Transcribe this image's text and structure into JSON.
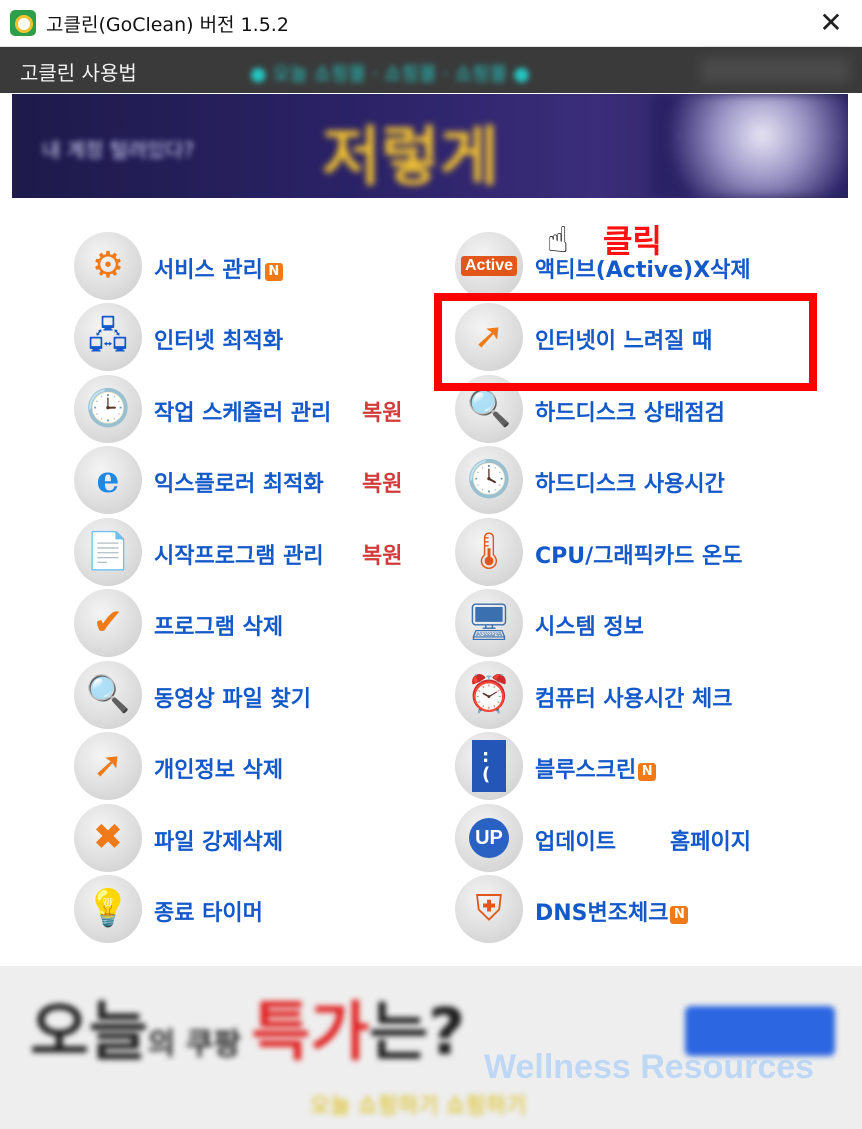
{
  "window": {
    "title": "고클린(GoClean) 버전 1.5.2",
    "close_glyph": "✕"
  },
  "menubar": {
    "usage": "고클린 사용법",
    "marquee": "● 오늘 쇼핑몰 · 쇼핑몰 · 쇼핑몰 ●"
  },
  "banner_top": {
    "small": "내 계정 털려있다?",
    "big": "저렇게"
  },
  "left_items": [
    {
      "label": "서비스 관리",
      "icon": "gear-icon",
      "badge": "N"
    },
    {
      "label": "인터넷 최적화",
      "icon": "network-icon"
    },
    {
      "label": "작업 스케줄러 관리",
      "icon": "scheduler-icon",
      "restore": "복원"
    },
    {
      "label": "익스플로러 최적화",
      "icon": "internet-explorer-icon",
      "restore": "복원"
    },
    {
      "label": "시작프로그램 관리",
      "icon": "document-icon",
      "restore": "복원"
    },
    {
      "label": "프로그램 삭제",
      "icon": "checkmark-icon"
    },
    {
      "label": "동영상 파일 찾기",
      "icon": "magnifier-icon"
    },
    {
      "label": "개인정보 삭제",
      "icon": "privacy-icon"
    },
    {
      "label": "파일 강제삭제",
      "icon": "delete-file-icon"
    },
    {
      "label": "종료 타이머",
      "icon": "sleep-bulb-icon"
    }
  ],
  "right_items": [
    {
      "label": "액티브(Active)X삭제",
      "icon": "activex-icon"
    },
    {
      "label": "인터넷이 느려질 때",
      "icon": "internet-slow-icon"
    },
    {
      "label": "하드디스크 상태점검",
      "icon": "disk-check-icon"
    },
    {
      "label": "하드디스크 사용시간",
      "icon": "disk-clock-icon"
    },
    {
      "label": "CPU/그래픽카드 온도",
      "icon": "thermometer-icon"
    },
    {
      "label": "시스템 정보",
      "icon": "computer-icon"
    },
    {
      "label": "컴퓨터 사용시간 체크",
      "icon": "clock-icon"
    },
    {
      "label": "블루스크린",
      "icon": "bluescreen-icon",
      "badge": "N"
    },
    {
      "label": "업데이트",
      "icon": "update-icon",
      "extra": "홈페이지"
    },
    {
      "label": "DNS변조체크",
      "icon": "shield-icon",
      "badge": "N"
    }
  ],
  "annotation": {
    "click": "클릭"
  },
  "banner_bottom": {
    "text_a": "오늘",
    "text_b": "의 쿠팡 ",
    "text_red": "특가",
    "text_c": "는?",
    "sub": "오늘 쇼핑하기 쇼핑하기"
  },
  "watermark": "Wellness Resources"
}
